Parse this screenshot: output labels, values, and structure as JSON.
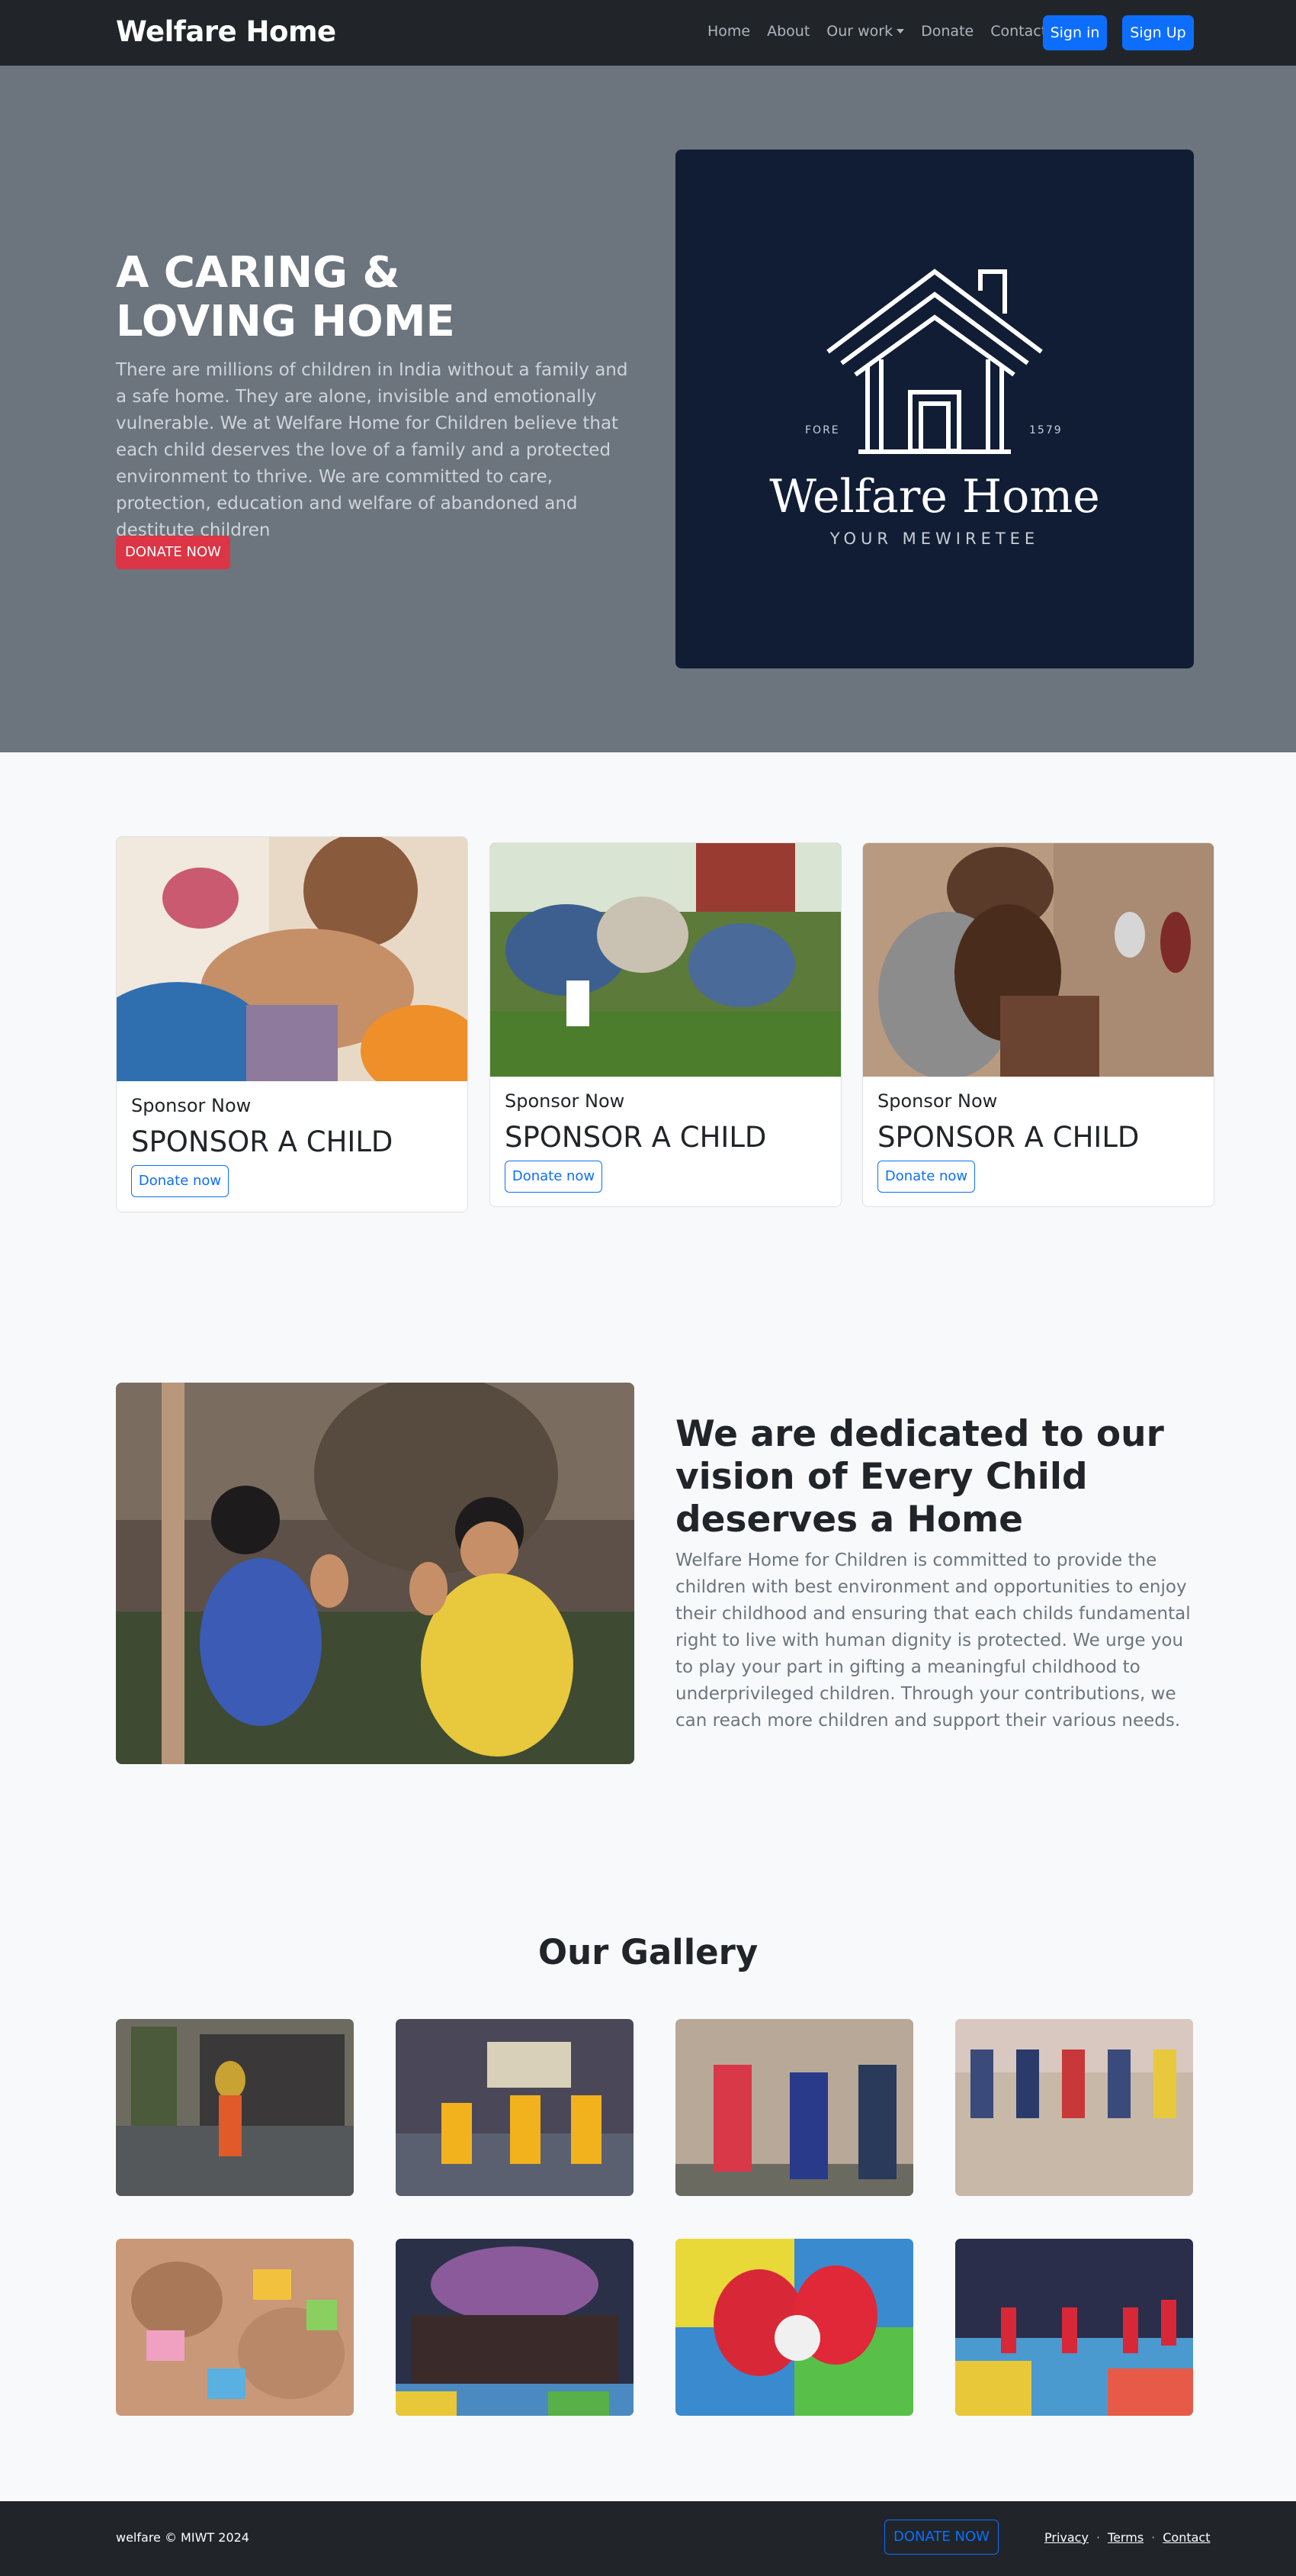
{
  "nav": {
    "brand": "Welfare Home",
    "links": [
      "Home",
      "About",
      "Our work",
      "Donate",
      "Contact us"
    ],
    "signin": "Sign in",
    "signup": "Sign Up"
  },
  "hero": {
    "title": "A CARING & LOVING HOME",
    "text": "There are millions of children in India without a family and a safe home. They are alone, invisible and emotionally vulnerable. We at Welfare Home for Children believe that each child deserves the love of a family and a protected environment to thrive. We are committed to care, protection, education and welfare of abandoned and destitute children",
    "donate": "DONATE NOW",
    "logo_name": "Welfare Home",
    "logo_tagline": "YOUR MEWIRETEE",
    "logo_left": "FORE",
    "logo_right": "1579"
  },
  "cards": [
    {
      "subtitle": "Sponsor Now",
      "title": "SPONSOR A CHILD",
      "button": "Donate now",
      "image": "children-hands-photo"
    },
    {
      "subtitle": "Sponsor Now",
      "title": "SPONSOR A CHILD",
      "button": "Donate now",
      "image": "children-gardening-photo"
    },
    {
      "subtitle": "Sponsor Now",
      "title": "SPONSOR A CHILD",
      "button": "Donate now",
      "image": "mother-child-photo"
    }
  ],
  "vision": {
    "title": "We are dedicated to our vision of Every Child deserves a Home",
    "text": "Welfare Home for Children is committed to provide the children with best environment and opportunities to enjoy their childhood and ensuring that each childs fundamental right to live with human dignity is protected. We urge you to play your part in gifting a meaningful childhood to underprivileged children. Through your contributions, we can reach more children and support their various needs.",
    "image": "children-clapping-photo"
  },
  "gallery": {
    "title": "Our Gallery",
    "images": [
      "dance-performance",
      "yellow-costume-dance",
      "kids-costumes-photo",
      "kids-group-outdoor",
      "craft-wristbands",
      "celebration-group",
      "santa-kids-floor",
      "santa-kids-stage"
    ]
  },
  "footer": {
    "copyright": "welfare © MIWT 2024",
    "donate": "DONATE NOW",
    "links": [
      "Privacy",
      "Terms",
      "Contact"
    ]
  },
  "colors": {
    "nav_bg": "#212529",
    "hero_bg": "#6c757d",
    "primary": "#0d6efd",
    "danger": "#dc3545",
    "logo_bg": "#101d35"
  }
}
